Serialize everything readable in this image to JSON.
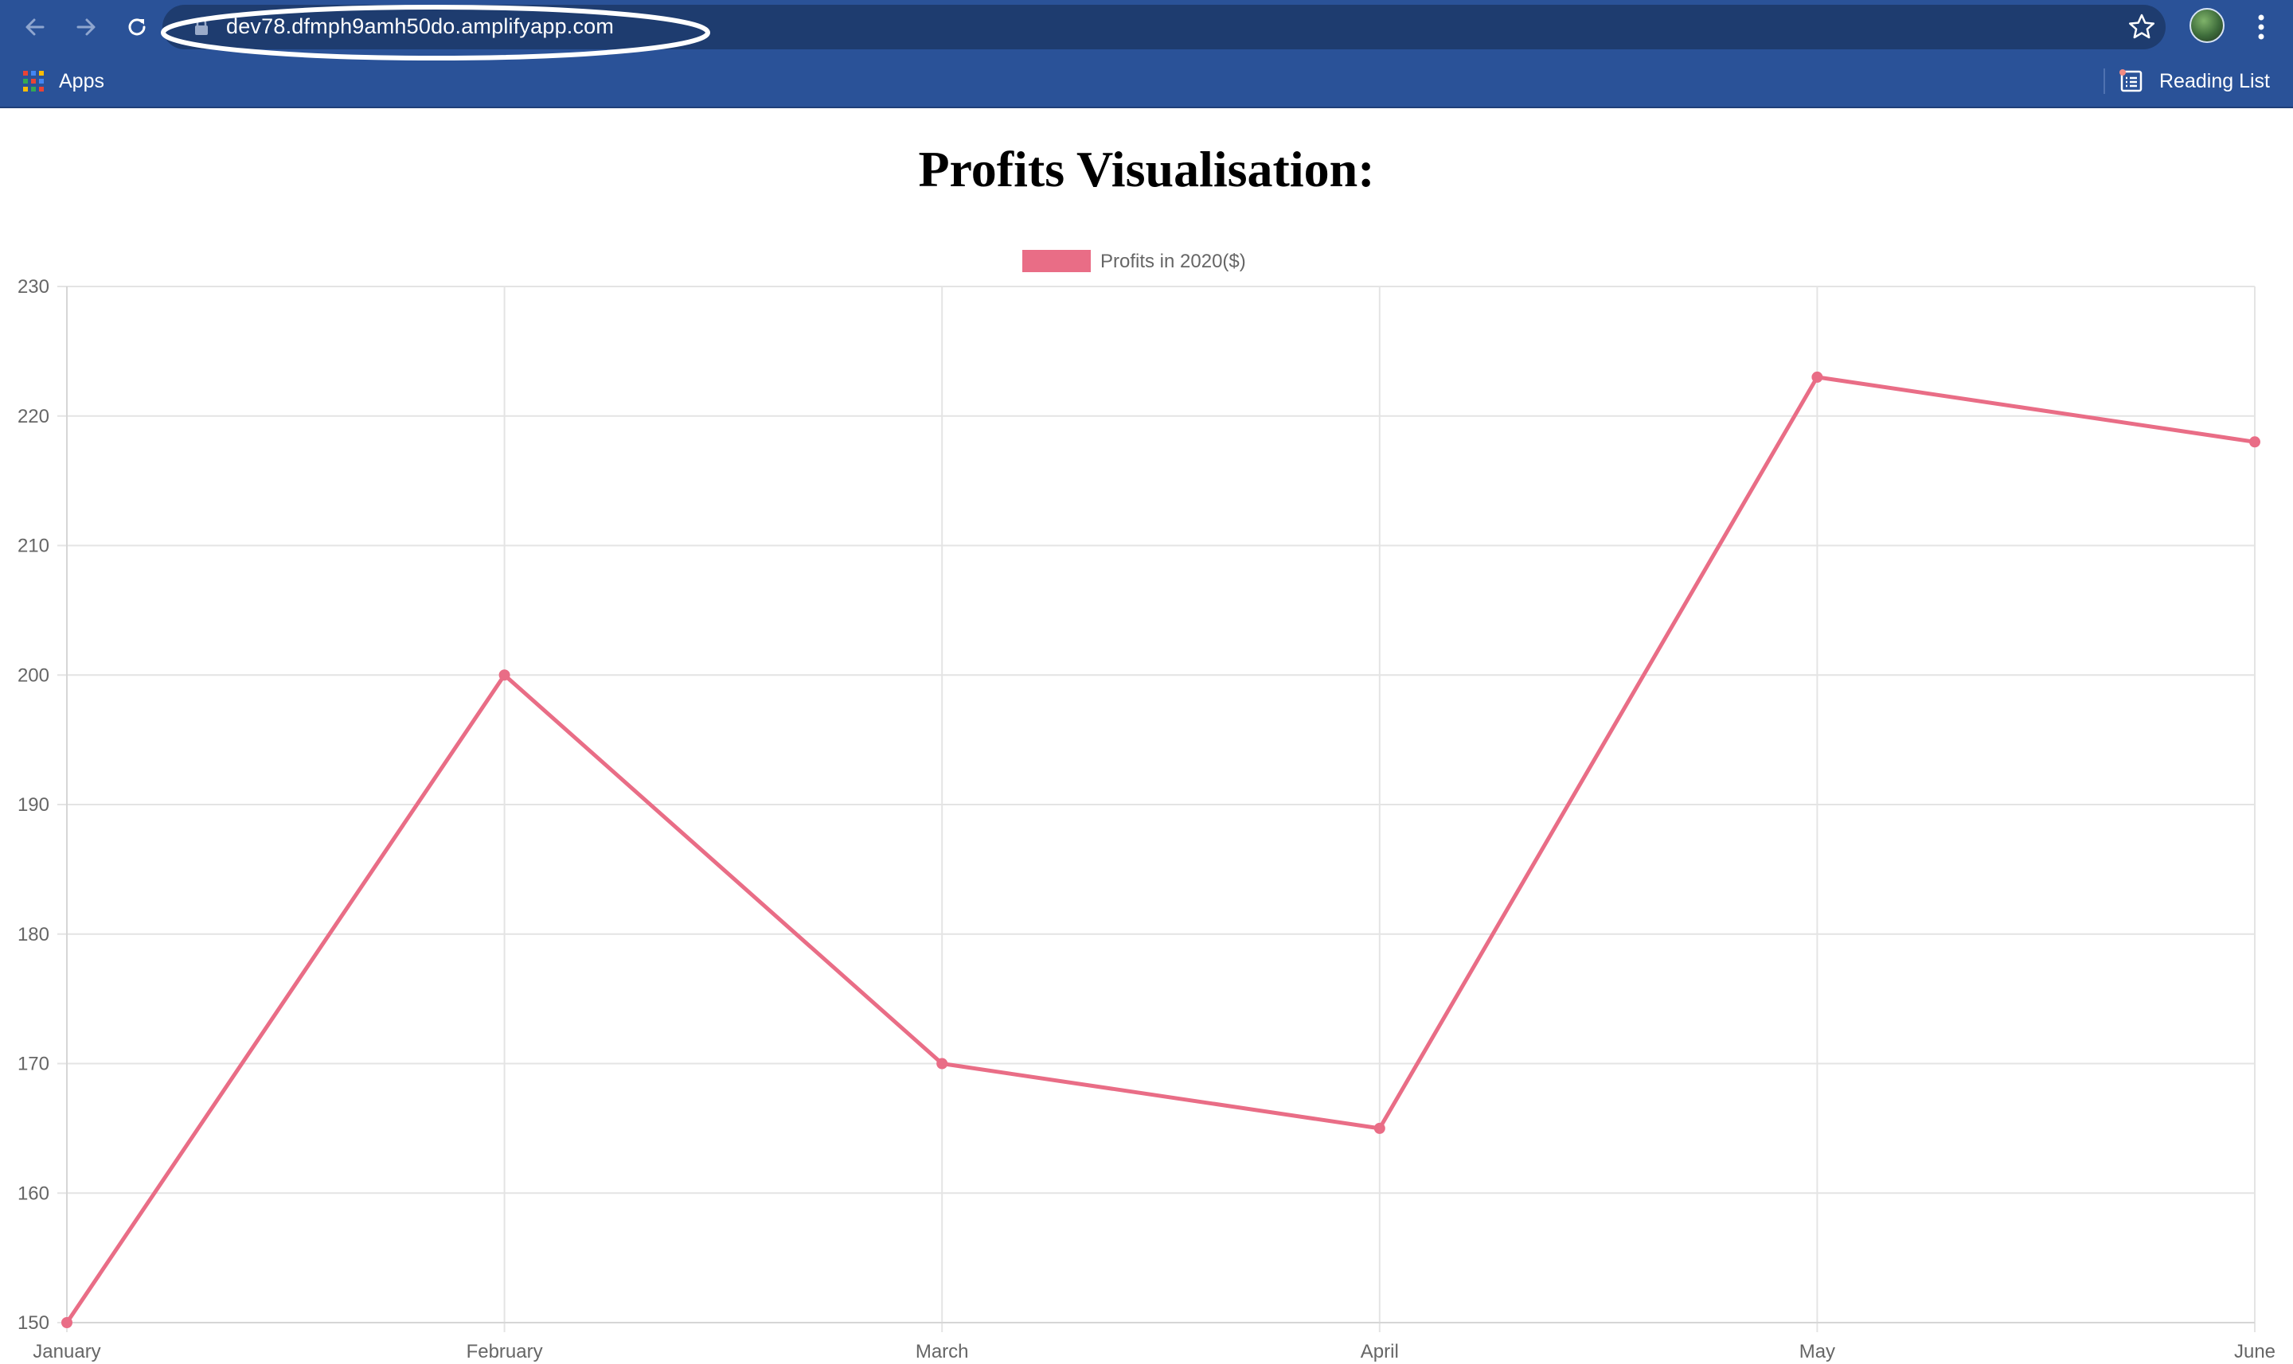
{
  "browser": {
    "url": "dev78.dfmph9amh50do.amplifyapp.com",
    "bookmarks": {
      "apps_label": "Apps",
      "reading_list_label": "Reading List"
    },
    "icons": {
      "back": "back-arrow-icon",
      "forward": "forward-arrow-icon",
      "reload": "reload-icon",
      "lock": "lock-icon",
      "star": "star-icon",
      "menu": "kebab-menu-icon",
      "apps": "apps-grid-icon",
      "reading_list": "reading-list-icon"
    },
    "colors": {
      "chrome_bg": "#2a5298",
      "omnibox_bg": "#1e3c6f",
      "url_highlight_ellipse": "#ffffff"
    }
  },
  "page": {
    "title": "Profits Visualisation:"
  },
  "chart_data": {
    "type": "line",
    "categories": [
      "January",
      "February",
      "March",
      "April",
      "May",
      "June"
    ],
    "series": [
      {
        "name": "Profits in 2020($)",
        "values": [
          150,
          200,
          170,
          165,
          223,
          218
        ],
        "color": "#e96d86"
      }
    ],
    "ylim": [
      150,
      230
    ],
    "yticks": [
      150,
      160,
      170,
      180,
      190,
      200,
      210,
      220,
      230
    ],
    "grid": true,
    "legend_position": "top-center"
  }
}
